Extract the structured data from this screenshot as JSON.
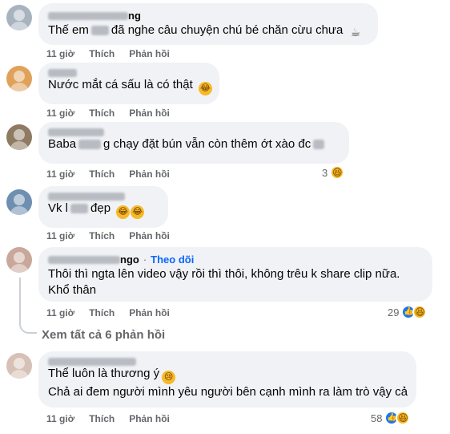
{
  "comments": [
    {
      "author_visible": "ng",
      "text_before": "Thế em",
      "text_after": "đã nghe câu chuyện chú bé chăn cừu chưa",
      "emoji": "coffee-cup",
      "time": "11 giờ",
      "like_label": "Thích",
      "reply_label": "Phản hồi",
      "avatar_color": "#a8b3c0"
    },
    {
      "author_visible": "",
      "text": "Nước mắt cá sấu là có thật",
      "emoji": "rolling-laugh",
      "time": "11 giờ",
      "like_label": "Thích",
      "reply_label": "Phản hồi",
      "avatar_color": "#e0a15a"
    },
    {
      "author_visible": "",
      "text_before": "Baba",
      "text_after": "g chạy đặt bún vẫn còn thêm ớt xào đc",
      "time": "11 giờ",
      "like_label": "Thích",
      "reply_label": "Phản hồi",
      "reaction_count": "3",
      "avatar_color": "#8e7b62"
    },
    {
      "author_visible": "",
      "text_before": "Vk l",
      "text_after": "đẹp",
      "emoji": "laugh-laugh",
      "time": "11 giờ",
      "like_label": "Thích",
      "reply_label": "Phản hồi",
      "avatar_color": "#6f8fb0"
    },
    {
      "author_visible": "ngo",
      "follow_label": "Theo dõi",
      "line1": "Thôi thì ngta lên video vậy rồi thì thôi, không trêu k share clip nữa.",
      "line2": "Khổ thân",
      "time": "11 giờ",
      "like_label": "Thích",
      "reply_label": "Phản hồi",
      "reaction_count": "29",
      "avatar_color": "#c9a79a"
    },
    {
      "author_visible": "",
      "line1": "Thể luôn là thương ý",
      "line2": "Chả ai đem người mình yêu người bên cạnh mình ra làm trò vậy cả",
      "emoji": "crying",
      "time": "11 giờ",
      "like_label": "Thích",
      "reply_label": "Phản hồi",
      "reaction_count": "58",
      "avatar_color": "#d7c0b5"
    }
  ],
  "view_replies_label": "Xem tất cả 6 phản hồi",
  "colors": {
    "bubble": "#f0f2f5",
    "meta_text": "#65676b",
    "follow": "#0866ff",
    "like_reaction": "#1877f2",
    "haha_reaction": "#f7b928"
  }
}
